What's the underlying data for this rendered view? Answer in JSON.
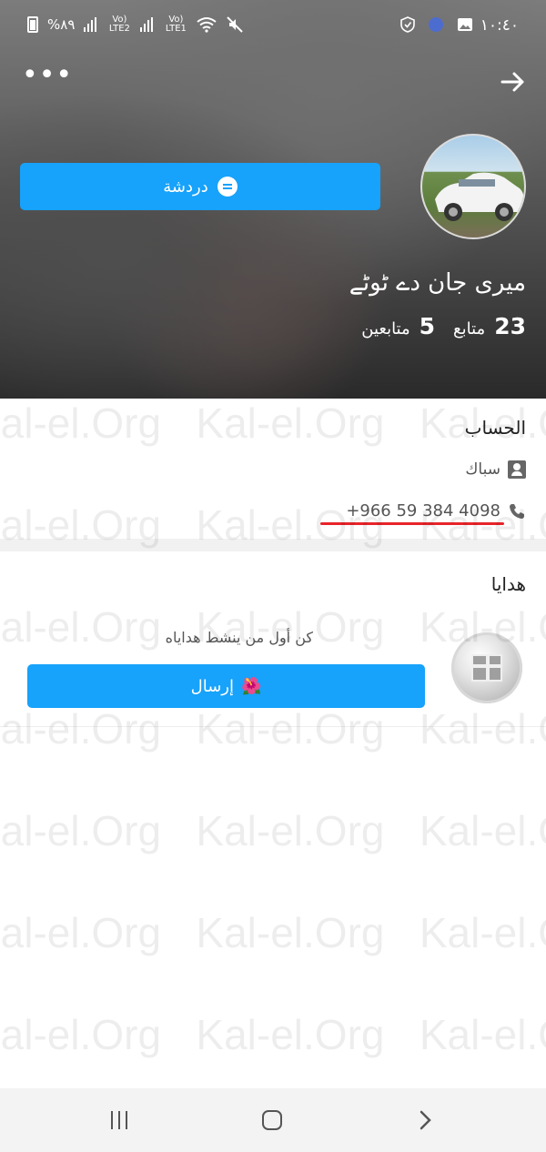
{
  "statusbar": {
    "time": "١٠:٤٠",
    "battery": "%٨٩",
    "sim2_label": "Vo) LTE2",
    "sim1_label": "Vo) LTE1"
  },
  "profile": {
    "chat_label": "دردشة",
    "username": "میری جان دے ٹوٹے",
    "followers_count": "23",
    "followers_label": "متابع",
    "following_count": "5",
    "following_label": "متابعين"
  },
  "account": {
    "title": "الحساب",
    "type_label": "سباك",
    "phone": "+966 59 384 4098"
  },
  "gifts": {
    "title": "هدايا",
    "empty_text": "كن أول من ينشط هداياه",
    "send_label": "إرسال",
    "send_emoji": "🌺"
  },
  "watermark": {
    "text": "Kal-el.Org"
  }
}
